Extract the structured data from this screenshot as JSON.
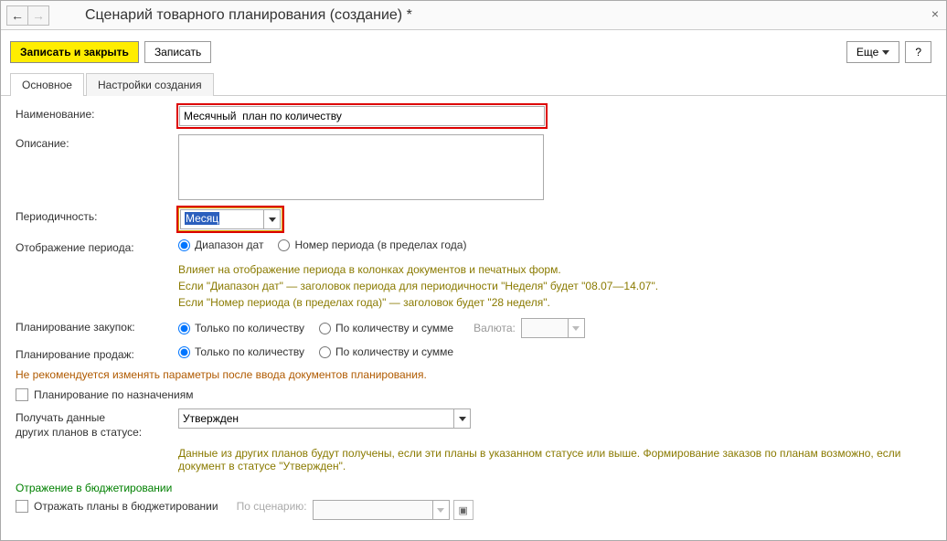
{
  "title": "Сценарий товарного планирования (создание) *",
  "toolbar": {
    "save_close": "Записать и закрыть",
    "save": "Записать",
    "more": "Еще",
    "help": "?"
  },
  "tabs": {
    "main": "Основное",
    "settings": "Настройки создания"
  },
  "labels": {
    "name": "Наименование:",
    "description": "Описание:",
    "periodicity": "Периодичность:",
    "period_display": "Отображение периода:",
    "purchase_planning": "Планирование закупок:",
    "sales_planning": "Планирование продаж:",
    "get_data_line1": "Получать данные",
    "get_data_line2": "других планов в статусе:",
    "currency": "Валюта:",
    "by_scenario": "По сценарию:"
  },
  "values": {
    "name": "Месячный  план по количеству",
    "description": "",
    "periodicity": "Месяц",
    "status": "Утвержден",
    "currency": "",
    "scenario": ""
  },
  "radios": {
    "date_range": "Диапазон дат",
    "period_number": "Номер периода (в пределах года)",
    "qty_only": "Только по количеству",
    "qty_sum": "По количеству и сумме"
  },
  "hints": {
    "period1": "Влияет на отображение периода в колонках документов и печатных форм.",
    "period2": "Если \"Диапазон дат\" — заголовок периода для периодичности \"Неделя\" будет \"08.07—14.07\".",
    "period3": "Если \"Номер периода (в пределах года)\" — заголовок будет \"28 неделя\".",
    "warn": "Не рекомендуется изменять параметры после ввода документов планирования.",
    "status_hint": "Данные из других планов будут получены, если эти планы в указанном статусе или выше. Формирование заказов по планам возможно, если документ в статусе \"Утвержден\"."
  },
  "checkboxes": {
    "by_purpose": "Планирование по назначениям",
    "reflect_budget": "Отражать планы в бюджетировании"
  },
  "headings": {
    "budget": "Отражение в бюджетировании"
  }
}
